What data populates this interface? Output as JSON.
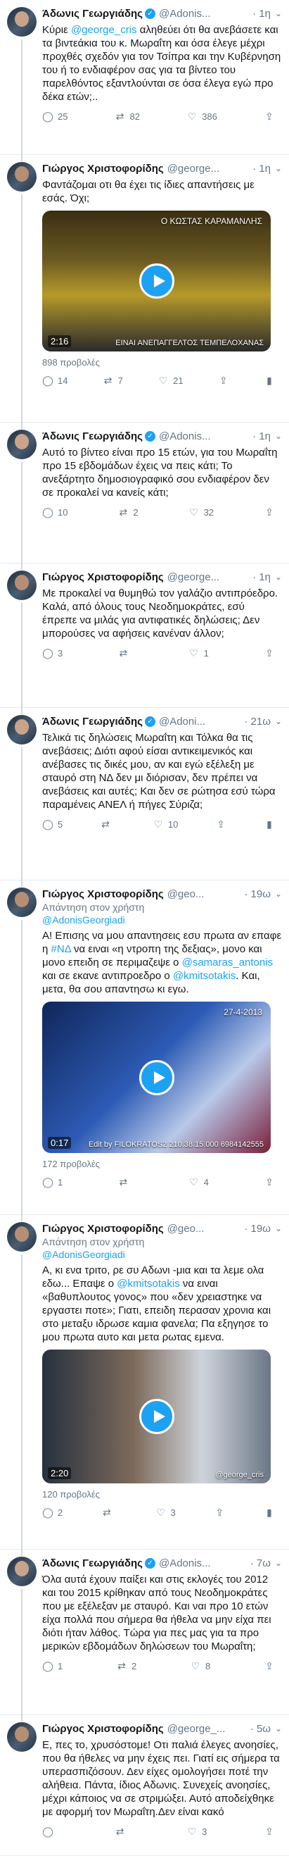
{
  "tweets": [
    {
      "name": "Άδωνις Γεωργιάδης",
      "handle": "@Adonis...",
      "time": "· 1η",
      "text": [
        "Κύριε ",
        "@george_cris",
        " αληθεύει ότι θα ανεβάσετε και τα βιντεάκια του κ. Μωραΐτη και όσα έλεγε μέχρι προχθές σχεδόν για τον Τσίπρα και την Κυβέρνηση του ή το ενδιαφέρον σας για τα βίντεο του παρελθόντος εξαντλούνται σε όσα έλεγα εγώ προ δέκα ετών;.."
      ],
      "reply": "25",
      "retweet": "82",
      "like": "386"
    },
    {
      "name": "Γιώργος Χριστοφορίδης",
      "handle": "@george...",
      "time": "· 1η",
      "text": [
        "Φαντάζομαι οτι θα έχει τις ίδιες απαντήσεις με εσάς. Όχι;"
      ],
      "video": {
        "duration": "2:16",
        "caption_top": "Ο ΚΩΣΤΑΣ ΚΑΡΑΜΑΝΛΗΣ",
        "caption_bottom": "ΕΙΝΑΙ ΑΝΕΠΑΓΓΕΛΤΟΣ ΤΕΜΠΕΛΟΧΑΝΑΣ"
      },
      "views": "898 προβολές",
      "reply": "14",
      "retweet": "7",
      "like": "21"
    },
    {
      "name": "Άδωνις Γεωργιάδης",
      "handle": "@Adonis...",
      "time": "· 1η",
      "text": [
        "Αυτό το βίντεο είναι προ 15 ετών, για του Μωραΐτη προ 15 εβδομάδων έχεις να πεις κάτι; Το ανεξάρτητο δημοσιογραφικό σου ενδιαφέρον δεν σε προκαλεί να κανείς κάτι;"
      ],
      "reply": "10",
      "retweet": "2",
      "like": "32"
    },
    {
      "name": "Γιώργος Χριστοφορίδης",
      "handle": "@george...",
      "time": "· 1η",
      "text": [
        "Με προκαλεί να θυμηθώ τον γαλάζιο αντιπρόεδρο. Καλά, από όλους τους Νεοδημοκράτες, εσύ έπρεπε να μιλάς για αντιφατικές δηλώσεις; Δεν μπορούσες να αφήσεις κανέναν άλλον;"
      ],
      "reply": "3",
      "retweet": "",
      "like": "1"
    },
    {
      "name": "Άδωνις Γεωργιάδης",
      "handle": "@Adoni...",
      "time": "· 21ω",
      "text": [
        "Τελικά τις δηλώσεις Μωραΐτη και Τόλκα θα τις ανεβάσεις; Διότι αφού είσαι αντικειμενικός και ανέβασες τις δικές μου, αν και εγώ εξέλεξη με σταυρό στη ΝΔ δεν μι διόρισαν, δεν πρέπει να ανεβάσεις και αυτές; Και δεν σε ρώτησα εσύ τώρα παραμένεις ΑΝΕΛ ή πήγες Σύριζα;"
      ],
      "reply": "5",
      "retweet": "",
      "like": "10"
    },
    {
      "name": "Γιώργος Χριστοφορίδης",
      "handle": "@geo...",
      "time": "· 19ω",
      "reply_label": "Απάντηση στον χρήστη",
      "reply_target": "@AdonisGeorgiadi",
      "text": [
        "Α! Επισης να μου απαντησεις εσυ πρωτα αν επαφε η ",
        "#ΝΔ",
        " να ειναι «η ντροπη της δεξιας», μονο και μονο επειδη σε περιμαζεψε ο ",
        "@samaras_antonis",
        " και σε εκανε αντιπροεδρο ο ",
        "@kmitsotakis",
        ". Και, μετα, θα σου απαντησω κι εγω."
      ],
      "video": {
        "duration": "0:17",
        "caption_top": "27-4-2013",
        "caption_bottom": "Edit by FILOKRATOS2  210.38.15.000  6984142555"
      },
      "views": "172 προβολές",
      "reply": "1",
      "retweet": "",
      "like": "4"
    },
    {
      "name": "Γιώργος Χριστοφορίδης",
      "handle": "@geo...",
      "time": "· 19ω",
      "reply_label": "Απάντηση στον χρήστη",
      "reply_target": "@AdonisGeorgiadi",
      "text": [
        "Α, κι ενα τριτο, ρε συ Αδωνι -μια και τα λεμε ολα εδω... Επαψε ο ",
        "@kmitsotakis",
        " να ειναι «βαθυπλουτος γονος» που «δεν χρειαστηκε να εργαστει ποτε»; Γιατι, επειδη περασαν χρονια και στο μεταξυ ιδρωσε καμια φανελα; Πα εξηγησε το μου πρωτα αυτο και μετα ρωτας εμενα."
      ],
      "video": {
        "duration": "2:20",
        "caption_top": "",
        "caption_bottom": "@george_cris"
      },
      "views": "120 προβολές",
      "reply": "2",
      "retweet": "",
      "like": "3"
    },
    {
      "name": "Άδωνις Γεωργιάδης",
      "handle": "@Adonis...",
      "time": "· 7ω",
      "text": [
        "Όλα αυτά έχουν παίξει και στις εκλογές του 2012 και του 2015 κρίθηκαν από τους Νεοδημοκράτες που με εξέλεξαν με σταυρό. Και ναι προ 10 ετών είχα πολλά που σήμερα θα ήθελα να μην είχα πει διότι ήταν λάθος. Τώρα για πες μας για τα προ μερικών εβδομάδων δηλώσεων του Μωραΐτη;"
      ],
      "reply": "1",
      "retweet": "2",
      "like": "8"
    },
    {
      "name": "Γιώργος Χριστοφορίδης",
      "handle": "@george_...",
      "time": "· 5ω",
      "text": [
        "Ε, πες το, χρυσόστομε! Οτι παλιά έλεγες ανοησίες, που θα ήθελες να μην έχεις πει. Γιατί εις σήμερα τα υπερασπιζόσουν. Δεν είχες ομολογήσει ποτέ την αλήθεια. Πάντα, ίδιος Αδωνις. Συνεχείς ανοησίες, μέχρι κάποιος να σε στριμώξει. Αυτό αποδείχθηκε με αφορμή τον Μωραΐτη.Δεν είναι κακό"
      ],
      "reply": "",
      "retweet": "",
      "like": "3"
    }
  ],
  "icons": {
    "reply": "reply-icon",
    "retweet": "retweet-icon",
    "like": "heart-icon",
    "share": "share-icon",
    "analytics": "analytics-icon",
    "verified": "verified-badge-icon"
  },
  "colors": {
    "link": "#1da1f2",
    "muted": "#657786",
    "text": "#14171a"
  }
}
